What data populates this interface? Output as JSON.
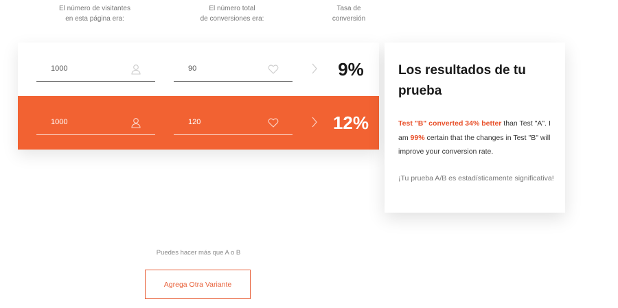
{
  "headers": {
    "visitors": [
      "El número de visitantes",
      "en esta página era:"
    ],
    "conversions": [
      "El número total",
      "de conversiones era:"
    ],
    "rate": [
      "Tasa de",
      "conversión"
    ]
  },
  "test_a": {
    "visitors": "1000",
    "conversions": "90",
    "rate": "9%"
  },
  "test_b": {
    "visitors": "1000",
    "conversions": "120",
    "rate": "12%"
  },
  "results": {
    "title": "Los resultados de tu prueba",
    "body": {
      "p1": "Test \"B\" converted 34% better",
      "p2": " than Test \"A\". I am ",
      "p3": "99%",
      "p4": " certain that the changes in Test \"B\" will improve your conversion rate."
    },
    "significance": "¡Tu prueba A/B es estadísticamente significativa!"
  },
  "more_text": "Puedes hacer más que A o B",
  "add_variant_label": "Agrega Otra Variante",
  "colors": {
    "accent": "#f26232",
    "highlight": "#e8502a"
  },
  "icons": {
    "visitors": "user-icon",
    "conversions": "heart-icon",
    "arrow": "chevron-right-icon"
  }
}
